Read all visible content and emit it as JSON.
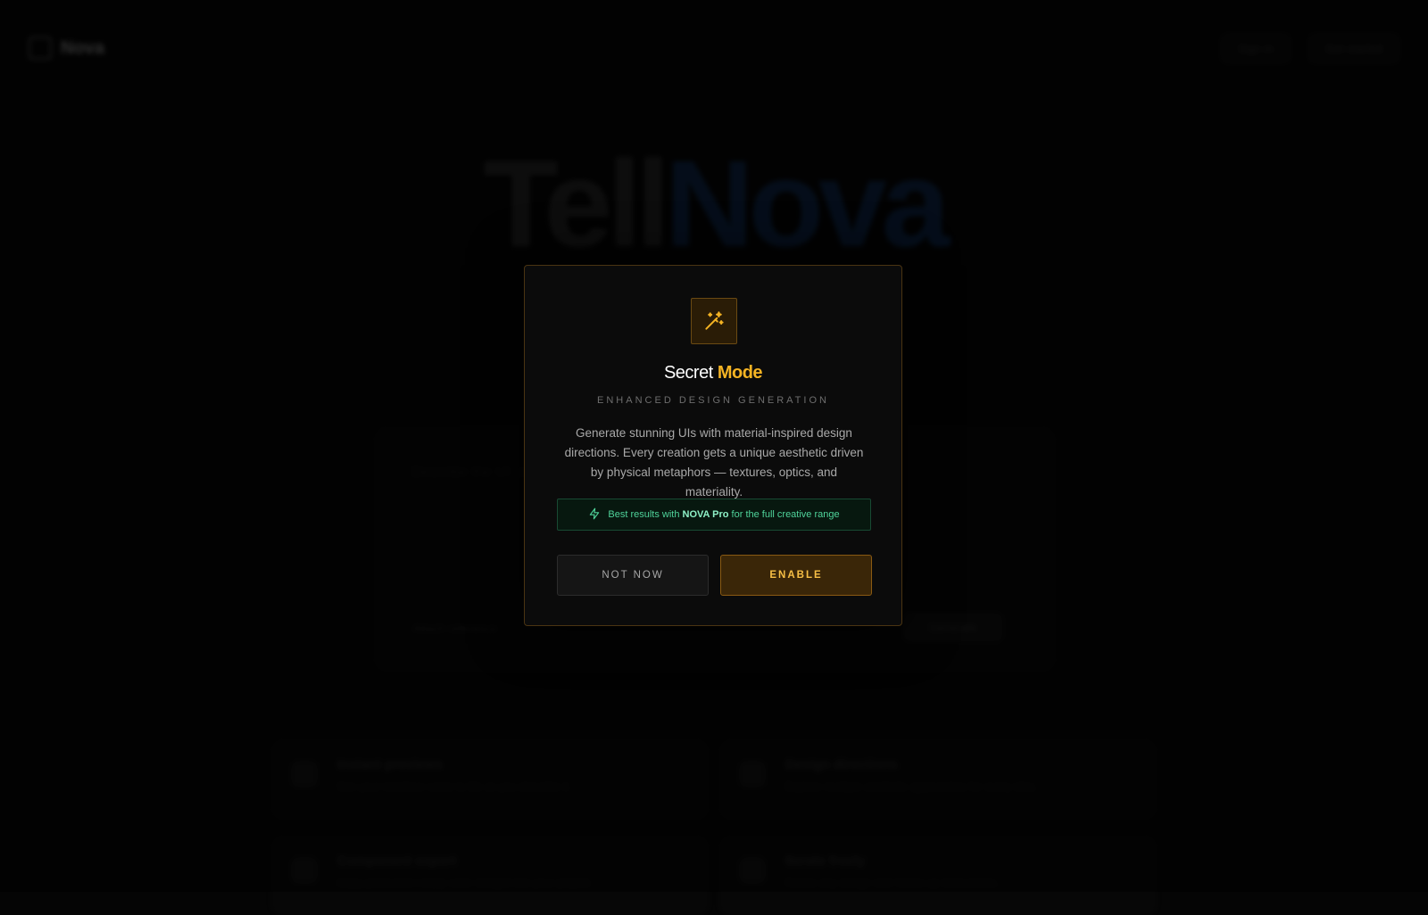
{
  "background": {
    "brand_name": "Nova",
    "top_actions": [
      "Sign in",
      "Get started"
    ],
    "hero": {
      "part1": "Tell",
      "part2": "Nova"
    },
    "prompt": {
      "placeholder": "Describe the UI you want to build...",
      "left_action": "Attach reference",
      "right_action": "Generate"
    },
    "features": [
      {
        "title": "Instant previews",
        "desc": "See your interface come to life as you describe it."
      },
      {
        "title": "Design directions",
        "desc": "Explore multiple aesthetic approaches for every idea."
      },
      {
        "title": "Component export",
        "desc": "Copy production-ready code straight into your project."
      },
      {
        "title": "Iterate freely",
        "desc": "Refine any design with follow-up instructions."
      }
    ]
  },
  "modal": {
    "icon": "magic-wand-icon",
    "title_plain": "Secret",
    "title_accent": "Mode",
    "subtitle": "ENHANCED DESIGN GENERATION",
    "description": "Generate stunning UIs with material-inspired design directions. Every creation gets a unique aesthetic driven by physical metaphors — textures, optics, and materiality.",
    "tip": {
      "icon": "lightning-icon",
      "prefix": "Best results with",
      "highlight": "NOVA Pro",
      "suffix": "for the full creative range"
    },
    "cancel_label": "NOT NOW",
    "confirm_label": "ENABLE"
  },
  "colors": {
    "accent": "#f4b323",
    "tip_green": "#4fd39a",
    "hero_blue": "#0f2b55"
  }
}
